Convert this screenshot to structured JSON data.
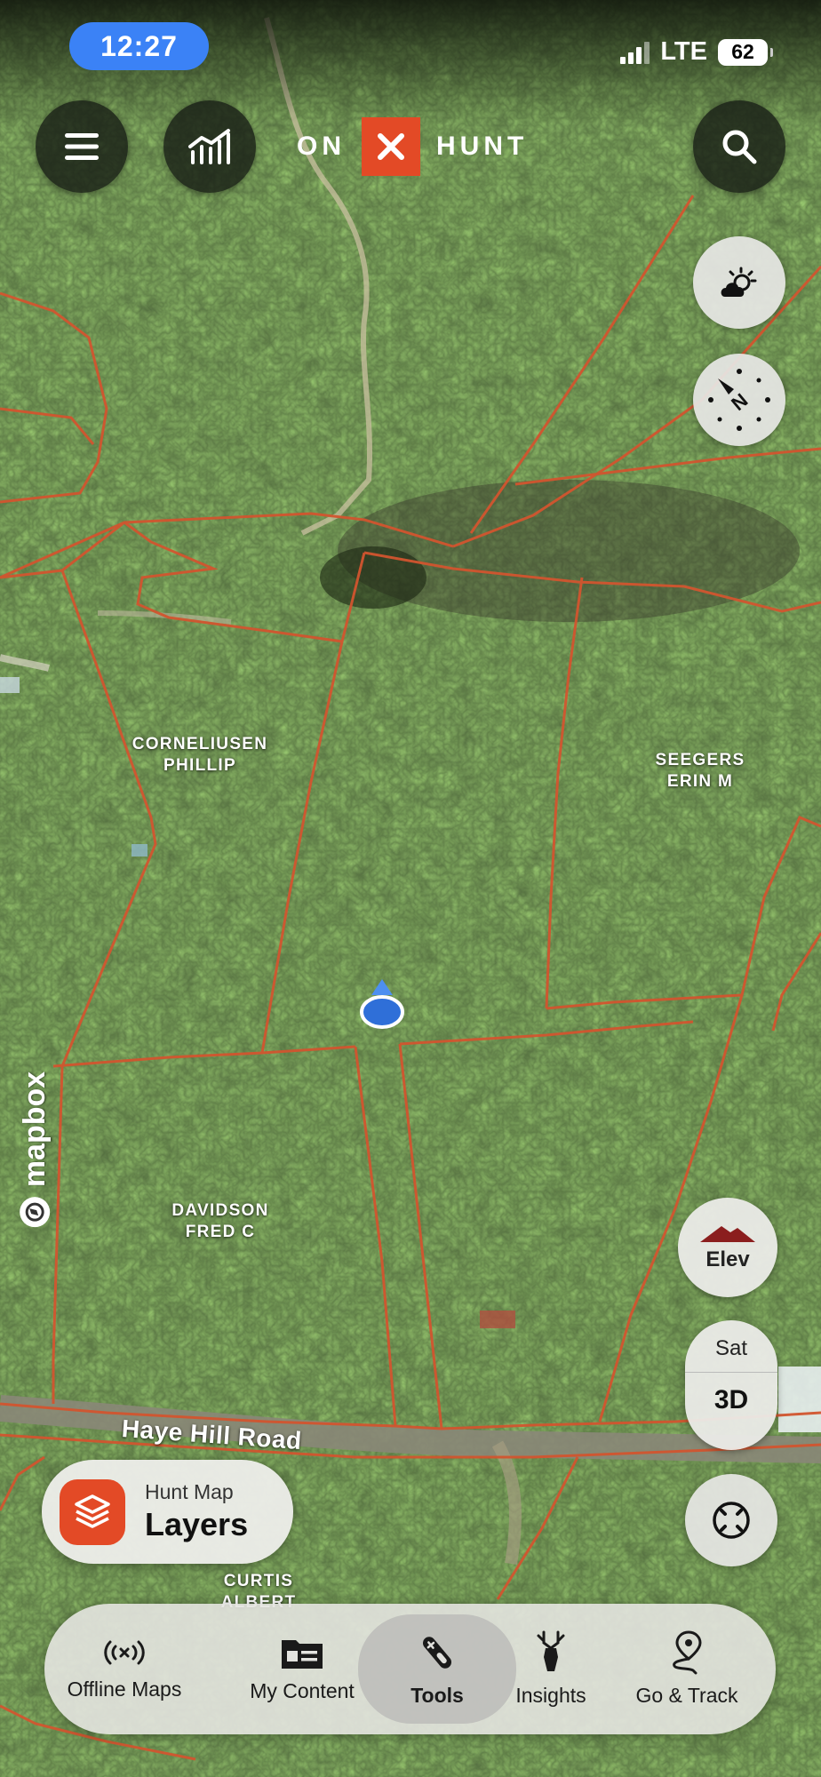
{
  "status": {
    "time": "12:27",
    "network": "LTE",
    "battery": "62"
  },
  "brand": {
    "left": "ON",
    "right": "HUNT"
  },
  "parcels": [
    {
      "line1": "CORNELIUSEN",
      "line2": "PHILLIP"
    },
    {
      "line1": "SEEGERS",
      "line2": "ERIN M"
    },
    {
      "line1": "DAVIDSON",
      "line2": "FRED C"
    },
    {
      "line1": "CURTIS",
      "line2": "ALBERT"
    }
  ],
  "road": "Haye Hill Road",
  "attribution": "mapbox",
  "layers": {
    "small": "Hunt Map",
    "big": "Layers"
  },
  "elev": {
    "label": "Elev"
  },
  "view_toggle": {
    "sat": "Sat",
    "three_d": "3D"
  },
  "nav": [
    {
      "label": "Offline Maps",
      "icon": "offline-maps-icon"
    },
    {
      "label": "My Content",
      "icon": "my-content-icon"
    },
    {
      "label": "Tools",
      "icon": "tools-icon",
      "active": true
    },
    {
      "label": "Insights",
      "icon": "deer-icon"
    },
    {
      "label": "Go & Track",
      "icon": "route-pin-icon"
    }
  ],
  "colors": {
    "accent": "#e34a26",
    "boundary": "#d2552f",
    "location": "#2f6fd8",
    "status_pill": "#3b82f6"
  }
}
